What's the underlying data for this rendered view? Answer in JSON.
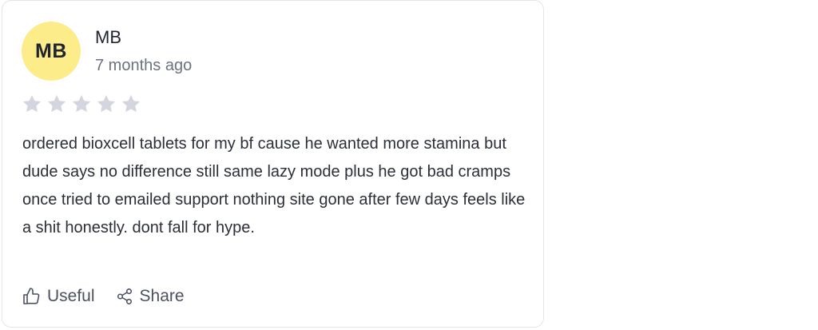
{
  "review": {
    "avatar_initials": "MB",
    "avatar_color": "#fdec8a",
    "author": "MB",
    "time_ago": "7 months ago",
    "rating": 0,
    "rating_max": 5,
    "star_empty_color": "#d3d6de",
    "text": "ordered bioxcell tablets for my bf cause he wanted more stamina but dude says no difference still same lazy mode plus he got bad cramps once tried to emailed support nothing site gone after few days feels like a shit honestly. dont fall for hype."
  },
  "actions": {
    "useful_label": "Useful",
    "useful_icon": "thumbs-up-icon",
    "share_label": "Share",
    "share_icon": "share-icon"
  }
}
